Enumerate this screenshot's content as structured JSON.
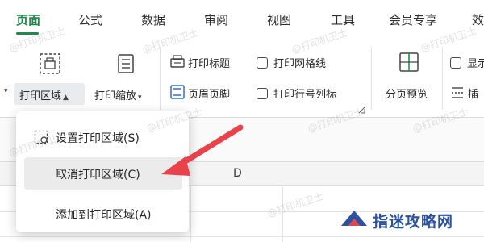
{
  "tabs": [
    {
      "label": "页面",
      "active": true
    },
    {
      "label": "公式",
      "active": false
    },
    {
      "label": "数据",
      "active": false
    },
    {
      "label": "审阅",
      "active": false
    },
    {
      "label": "视图",
      "active": false
    },
    {
      "label": "工具",
      "active": false
    },
    {
      "label": "会员专享",
      "active": false
    },
    {
      "label": "效",
      "active": false
    }
  ],
  "ribbon": {
    "print_area": "打印区域",
    "print_scale": "打印缩放",
    "print_titles": "打印标题",
    "header_footer": "页眉页脚",
    "print_gridlines": "打印网格线",
    "print_row_col_headers": "打印行号列标",
    "page_break_preview": "分页预览",
    "show_partial": "显示",
    "insert_partial": "插"
  },
  "menu": {
    "items": [
      {
        "label": "设置打印区域(S)"
      },
      {
        "label": "取消打印区域(C)"
      },
      {
        "label": "添加到打印区域(A)"
      }
    ]
  },
  "sheet": {
    "column_letter": "D"
  },
  "watermark": "@打印机卫士",
  "brand": {
    "name": "指迷攻略网"
  },
  "colors": {
    "accent": "#1f8a4c",
    "arrow": "#e8424a",
    "brand": "#2a52a0"
  },
  "icons": [
    "print-area-icon",
    "print-scale-icon",
    "print-titles-icon",
    "header-footer-icon",
    "page-break-preview-icon",
    "insert-icon",
    "set-print-area-icon",
    "dialog-launcher-icon",
    "arrow-pointer-icon",
    "brand-logo-icon"
  ]
}
